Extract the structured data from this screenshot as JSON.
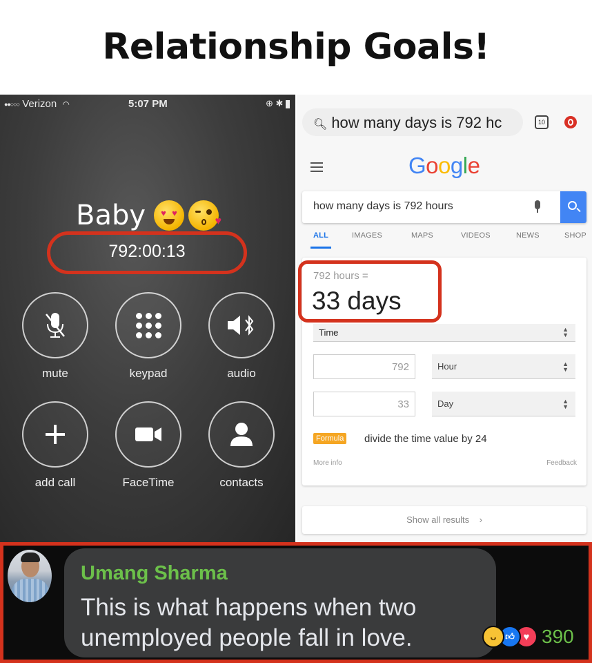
{
  "title": "Relationship Goals!",
  "call": {
    "carrier": "Verizon",
    "time": "5:07 PM",
    "caller_name": "Baby",
    "duration": "792:00:13",
    "buttons": [
      {
        "label": "mute",
        "icon": "microphone-muted-icon"
      },
      {
        "label": "keypad",
        "icon": "keypad-icon"
      },
      {
        "label": "audio",
        "icon": "bluetooth-audio-icon"
      },
      {
        "label": "add call",
        "icon": "plus-icon"
      },
      {
        "label": "FaceTime",
        "icon": "video-camera-icon"
      },
      {
        "label": "contacts",
        "icon": "contact-person-icon"
      }
    ]
  },
  "google": {
    "address_bar_text": "how many days is 792 hc",
    "tab_count": "10",
    "logo": "Google",
    "query": "how many days is 792 hours",
    "tabs": [
      "ALL",
      "IMAGES",
      "MAPS",
      "VIDEOS",
      "NEWS",
      "SHOP"
    ],
    "active_tab": "ALL",
    "conversion": {
      "equation": "792 hours =",
      "result": "33 days",
      "unit_type": "Time",
      "from_value": "792",
      "from_unit": "Hour",
      "to_value": "33",
      "to_unit": "Day",
      "formula_label": "Formula",
      "formula_text": "divide the time value by 24",
      "more_info": "More info",
      "feedback": "Feedback"
    },
    "show_all": "Show all results"
  },
  "comment": {
    "author": "Umang Sharma",
    "text": "This is what happens when two unemployed people fall in love.",
    "reaction_count": "390",
    "colors": {
      "author": "#6cc04a",
      "highlight": "#d4321d"
    }
  }
}
